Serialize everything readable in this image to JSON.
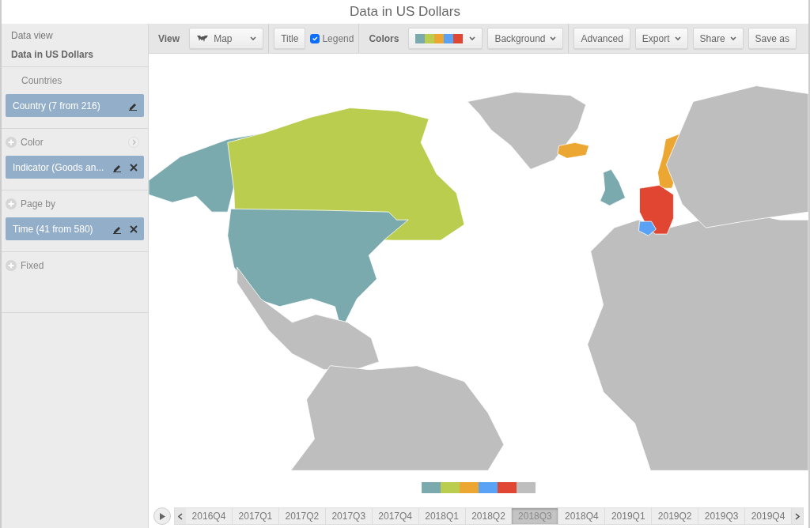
{
  "title": "Data in US Dollars",
  "sidebar": {
    "data_view_label": "Data view",
    "data_view": "Data in US Dollars",
    "sections": [
      {
        "label": "Countries",
        "add_icon": false,
        "arrow_icon": false,
        "chips": [
          {
            "label": "Country (7 from 216)",
            "removable": false
          }
        ]
      },
      {
        "label": "Color",
        "add_icon": true,
        "arrow_icon": true,
        "chips": [
          {
            "label": "Indicator (Goods an...",
            "removable": true
          }
        ]
      },
      {
        "label": "Page by",
        "add_icon": true,
        "arrow_icon": false,
        "chips": [
          {
            "label": "Time (41 from 580)",
            "removable": true
          }
        ]
      },
      {
        "label": "Fixed",
        "add_icon": true,
        "arrow_icon": false
      }
    ]
  },
  "toolbar": {
    "groups": [
      [
        {
          "kind": "label",
          "label": "View"
        },
        {
          "kind": "dropdown",
          "label": "Map"
        }
      ],
      [
        {
          "kind": "button",
          "label": "Title"
        },
        {
          "kind": "checkbox",
          "label": "Legend",
          "checked": true
        }
      ],
      [
        {
          "kind": "label",
          "label": "Colors"
        },
        {
          "kind": "palette",
          "swatches": [
            {
              "color": "#7aaaad"
            },
            {
              "color": "#bacd4f"
            },
            {
              "color": "#eca632"
            },
            {
              "color": "#5aa2f5"
            },
            {
              "color": "#e04632"
            }
          ]
        },
        {
          "kind": "dropdown",
          "label": "Background"
        }
      ],
      [
        {
          "kind": "button",
          "label": "Advanced"
        },
        {
          "kind": "dropdown",
          "label": "Export"
        },
        {
          "kind": "dropdown",
          "label": "Share"
        },
        {
          "kind": "button",
          "label": "Save as"
        }
      ]
    ]
  },
  "legend": {
    "swatches": [
      {
        "color": "#7aaaad"
      },
      {
        "color": "#bacd4f"
      },
      {
        "color": "#eca632"
      },
      {
        "color": "#5aa2f5"
      },
      {
        "color": "#e04632"
      },
      {
        "color": "#bebebe"
      }
    ]
  },
  "timeline": {
    "periods": [
      {
        "label": "2016Q4",
        "selected": false
      },
      {
        "label": "2017Q1",
        "selected": false
      },
      {
        "label": "2017Q2",
        "selected": false
      },
      {
        "label": "2017Q3",
        "selected": false
      },
      {
        "label": "2017Q4",
        "selected": false
      },
      {
        "label": "2018Q1",
        "selected": false
      },
      {
        "label": "2018Q2",
        "selected": false
      },
      {
        "label": "2018Q3",
        "selected": true
      },
      {
        "label": "2018Q4",
        "selected": false
      },
      {
        "label": "2019Q1",
        "selected": false
      },
      {
        "label": "2019Q2",
        "selected": false
      },
      {
        "label": "2019Q3",
        "selected": false
      },
      {
        "label": "2019Q4",
        "selected": false
      }
    ]
  }
}
